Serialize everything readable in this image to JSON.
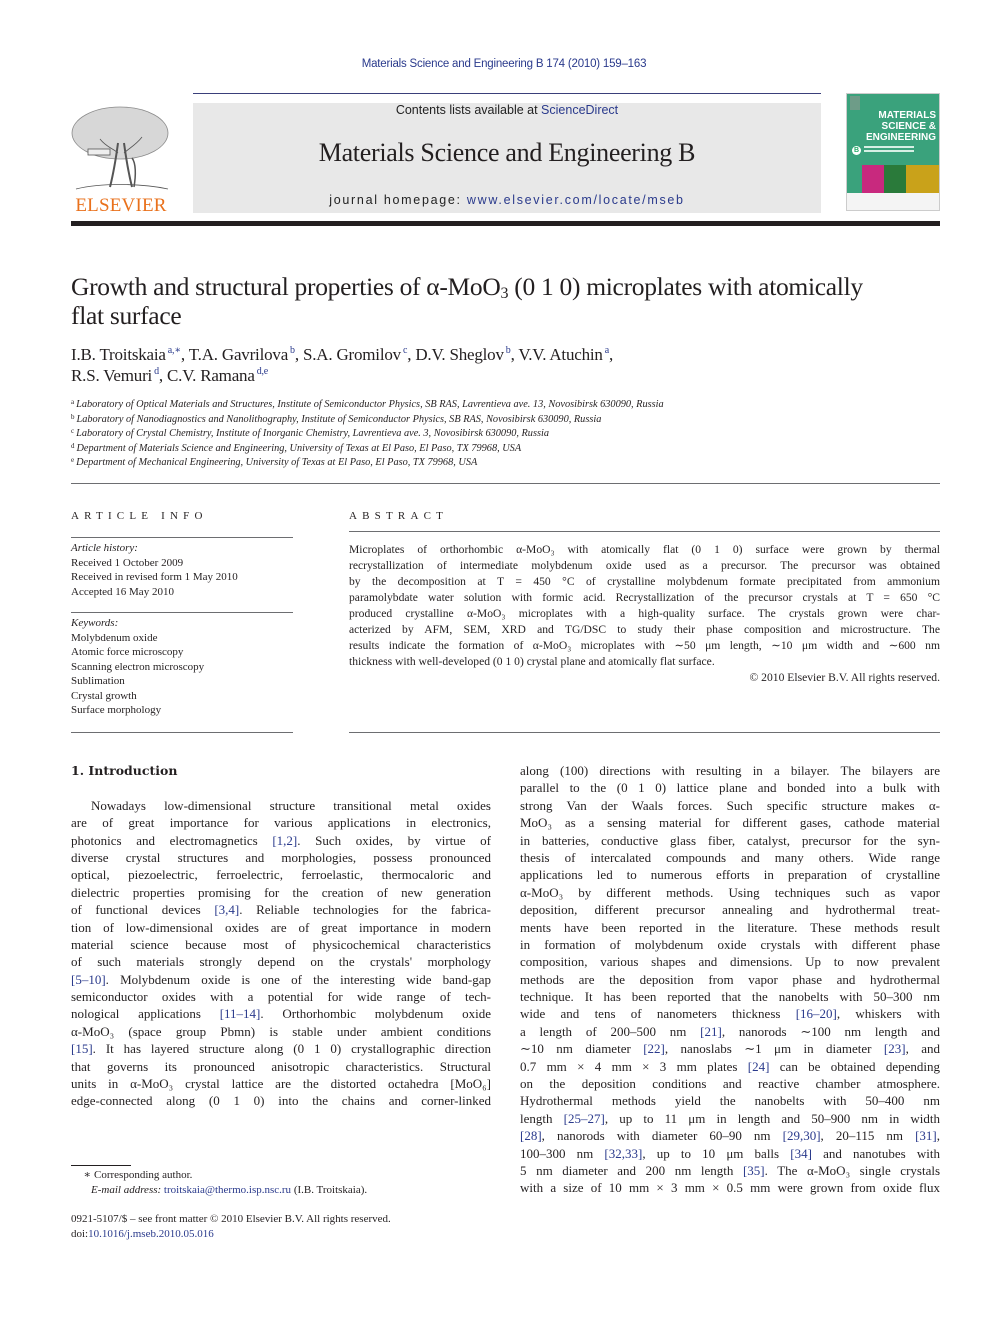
{
  "running_head": "Materials Science and Engineering B 174 (2010) 159–163",
  "masthead": {
    "publisher_logo_text": "ELSEVIER",
    "contents_prefix": "Contents lists available at ",
    "contents_link": "ScienceDirect",
    "journal_title": "Materials Science and Engineering B",
    "homepage_prefix": "journal homepage: ",
    "homepage_link": "www.elsevier.com/locate/mseb",
    "cover": {
      "title_lines": [
        "MATERIALS",
        "SCIENCE &",
        "ENGINEERING"
      ],
      "badge": "B",
      "colors": {
        "background": "#3aa27c",
        "image1": "#c8297e",
        "image2": "#2a7a3a",
        "image3": "#c9a21a"
      }
    }
  },
  "colors": {
    "link": "#2a3a8c",
    "elsevier_orange": "#e9711c",
    "masthead_bg": "#e8e8e8",
    "text": "#231f20"
  },
  "article": {
    "title_pre": "Growth and structural properties of α-MoO",
    "title_sub": "3",
    "title_post": " (0 1 0) microplates with atomically",
    "title_line2": "flat surface",
    "authors": [
      {
        "name": "I.B. Troitskaia",
        "aff": "a,∗",
        "sep": ", "
      },
      {
        "name": "T.A. Gavrilova",
        "aff": "b",
        "sep": ", "
      },
      {
        "name": "S.A. Gromilov",
        "aff": "c",
        "sep": ", "
      },
      {
        "name": "D.V. Sheglov",
        "aff": "b",
        "sep": ", "
      },
      {
        "name": "V.V. Atuchin",
        "aff": "a",
        "sep": ","
      },
      {
        "name": "R.S. Vemuri",
        "aff": "d",
        "sep": ", "
      },
      {
        "name": "C.V. Ramana",
        "aff": "d,e",
        "sep": ""
      }
    ],
    "affiliations": [
      {
        "key": "a",
        "text": "Laboratory of Optical Materials and Structures, Institute of Semiconductor Physics, SB RAS, Lavrentieva ave. 13, Novosibirsk 630090, Russia"
      },
      {
        "key": "b",
        "text": "Laboratory of Nanodiagnostics and Nanolithography, Institute of Semiconductor Physics, SB RAS, Novosibirsk 630090, Russia"
      },
      {
        "key": "c",
        "text": "Laboratory of Crystal Chemistry, Institute of Inorganic Chemistry, Lavrentieva ave. 3, Novosibirsk 630090, Russia"
      },
      {
        "key": "d",
        "text": "Department of Materials Science and Engineering, University of Texas at El Paso, El Paso, TX 79968, USA"
      },
      {
        "key": "e",
        "text": "Department of Mechanical Engineering, University of Texas at El Paso, El Paso, TX 79968, USA"
      }
    ]
  },
  "article_info": {
    "heading": "ARTICLE INFO",
    "history_label": "Article history:",
    "history": [
      "Received 1 October 2009",
      "Received in revised form 1 May 2010",
      "Accepted 16 May 2010"
    ],
    "keywords_label": "Keywords:",
    "keywords": [
      "Molybdenum oxide",
      "Atomic force microscopy",
      "Scanning electron microscopy",
      "Sublimation",
      "Crystal growth",
      "Surface morphology"
    ]
  },
  "abstract": {
    "heading": "ABSTRACT",
    "lines": [
      "Microplates of orthorhombic α-MoO₃ with atomically flat (0 1 0) surface were grown by thermal",
      "recrystallization of intermediate molybdenum oxide used as a precursor. The precursor was obtained",
      "by the decomposition at T = 450 °C of crystalline molybdenum formate precipitated from ammonium",
      "paramolybdate water solution with formic acid. Recrystallization of the precursor crystals at T = 650 °C",
      "produced crystalline α-MoO₃ microplates with a high-quality surface. The crystals grown were char-",
      "acterized by AFM, SEM, XRD and TG/DSC to study their phase composition and microstructure. The",
      "results indicate the formation of α-MoO₃ microplates with ∼50 μm length, ∼10 μm width and ∼600 nm",
      "thickness with well-developed (0 1 0) crystal plane and atomically flat surface."
    ],
    "copyright": "© 2010 Elsevier B.V. All rights reserved."
  },
  "body": {
    "section_heading": "1.  Introduction",
    "left_lines": [
      "Nowadays low-dimensional structure transitional metal oxides",
      "are of great importance for various applications in electronics,",
      "photonics and electromagnetics [1,2]. Such oxides, by virtue of",
      "diverse crystal structures and morphologies, possess pronounced",
      "optical, piezoelectric, ferroelectric, ferroelastic, thermocaloric and",
      "dielectric properties promising for the creation of new generation",
      "of functional devices [3,4]. Reliable technologies for the fabrica-",
      "tion of low-dimensional oxides are of great importance in modern",
      "material science because most of physicochemical characteristics",
      "of such materials strongly depend on the crystals' morphology",
      "[5–10]. Molybdenum oxide is one of the interesting wide band-gap",
      "semiconductor oxides with a potential for wide range of tech-",
      "nological applications [11–14]. Orthorhombic molybdenum oxide",
      "α-MoO₃ (space group Pbmn) is stable under ambient conditions",
      "[15]. It has layered structure along (0 1 0) crystallographic direction",
      "that governs its pronounced anisotropic characteristics. Structural",
      "units in α-MoO₃ crystal lattice are the distorted octahedra [MoO₆]",
      "edge-connected along (0 1 0) into the chains and corner-linked"
    ],
    "right_lines": [
      "along (100) directions with resulting in a bilayer. The bilayers are",
      "parallel to the (0 1 0) lattice plane and bonded into a bulk with",
      "strong Van der Waals forces. Such specific structure makes α-",
      "MoO₃ as a sensing material for different gases, cathode material",
      "in batteries, conductive glass fiber, catalyst, precursor for the syn-",
      "thesis of intercalated compounds and many others. Wide range",
      "applications led to numerous efforts in preparation of crystalline",
      "α-MoO₃ by different methods. Using techniques such as vapor",
      "deposition, different precursor annealing and hydrothermal treat-",
      "ments have been reported in the literature. These methods result",
      "in formation of molybdenum oxide crystals with different phase",
      "composition, various shapes and dimensions. Up to now prevalent",
      "methods are the deposition from vapor phase and hydrothermal",
      "technique. It has been reported that the nanobelts with 50–300 nm",
      "wide and tens of nanometers thickness [16–20], whiskers with",
      "a length of 200–500 nm [21], nanorods ∼100 nm length and",
      "∼10 nm diameter [22], nanoslabs ∼1 μm in diameter [23], and",
      "0.7 mm × 4 mm × 3 mm plates [24] can be obtained depending",
      "on the deposition conditions and reactive chamber atmosphere.",
      "Hydrothermal methods yield the nanobelts with 50–400 nm",
      "length [25–27], up to 11 μm in length and 50–900 nm in width",
      "[28], nanorods with diameter 60–90 nm [29,30], 20–115 nm [31],",
      "100–300 nm [32,33], up to 10 μm balls [34] and nanotubes with",
      "5 nm diameter and 200 nm length [35]. The α-MoO₃ single crystals",
      "with a size of 10 mm × 3 mm × 0.5 mm were grown from oxide flux"
    ]
  },
  "footnotes": {
    "star": "∗",
    "corresponding": "Corresponding author.",
    "email_label": "E-mail address:",
    "email": "troitskaia@thermo.isp.nsc.ru",
    "email_owner": " (I.B. Troitskaia).",
    "front_matter": "0921-5107/$ – see front matter © 2010 Elsevier B.V. All rights reserved.",
    "doi_label": "doi:",
    "doi": "10.1016/j.mseb.2010.05.016"
  }
}
